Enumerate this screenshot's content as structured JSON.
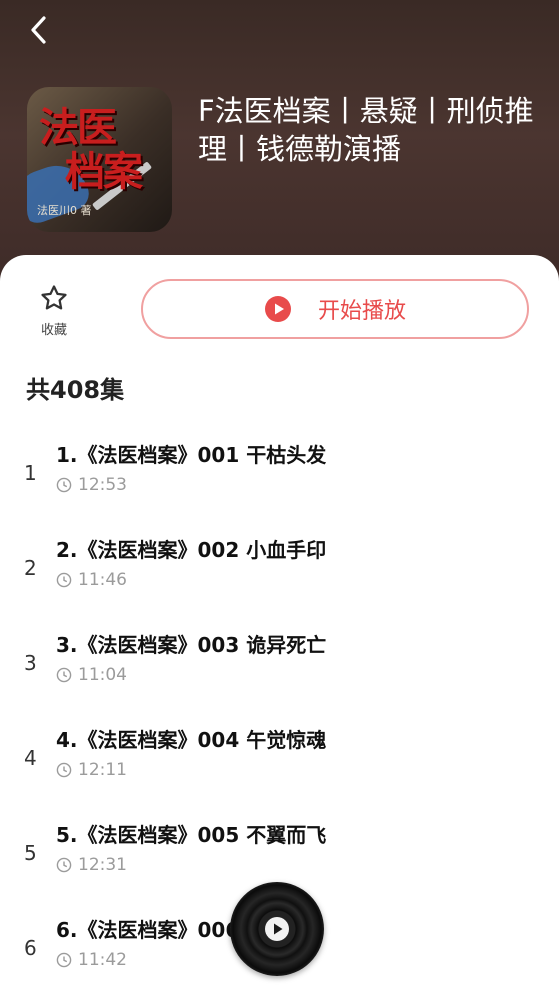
{
  "album": {
    "title": "F法医档案丨悬疑丨刑侦推理丨钱德勒演播",
    "cover_text_1": "法医",
    "cover_text_2": "档案",
    "cover_author": "法医川0 著"
  },
  "actions": {
    "favorite_label": "收藏",
    "play_label": "开始播放"
  },
  "episode_count_label": "共408集",
  "episodes": [
    {
      "index": "1",
      "title": "1.《法医档案》001 干枯头发",
      "duration": "12:53"
    },
    {
      "index": "2",
      "title": "2.《法医档案》002 小血手印",
      "duration": "11:46"
    },
    {
      "index": "3",
      "title": "3.《法医档案》003 诡异死亡",
      "duration": "11:04"
    },
    {
      "index": "4",
      "title": "4.《法医档案》004 午觉惊魂",
      "duration": "12:11"
    },
    {
      "index": "5",
      "title": "5.《法医档案》005 不翼而飞",
      "duration": "12:31"
    },
    {
      "index": "6",
      "title": "6.《法医档案》006 鸳鸯离",
      "duration": "11:42"
    }
  ],
  "colors": {
    "accent": "#e84b4b",
    "button_border": "#f0a0a0",
    "hero_bg": "#3d2a27",
    "muted_text": "#9b9b9b"
  },
  "icons": {
    "back": "chevron-left-icon",
    "favorite": "star-outline-icon",
    "play": "play-circle-icon",
    "clock": "clock-icon",
    "player": "vinyl-disc-icon"
  }
}
